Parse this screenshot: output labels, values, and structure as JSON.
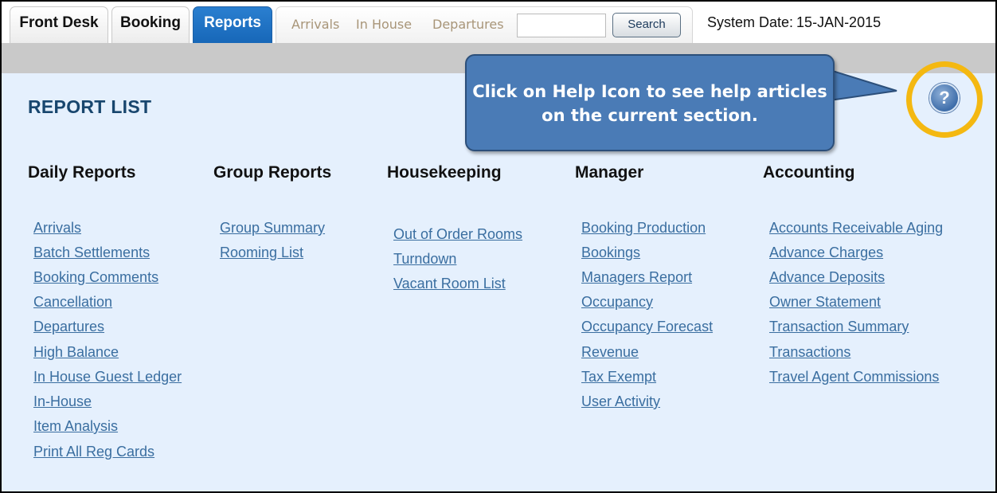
{
  "tabs": {
    "front_desk": "Front Desk",
    "booking": "Booking",
    "reports": "Reports"
  },
  "subnav": {
    "arrivals": "Arrivals",
    "in_house": "In House",
    "departures": "Departures",
    "search_value": "",
    "search_button": "Search"
  },
  "system_date": {
    "label": "System Date:",
    "value": "15-JAN-2015"
  },
  "page_title": "REPORT LIST",
  "callout": {
    "line1": "Click on Help Icon to see help articles",
    "line2": "on the current section."
  },
  "help_icon_glyph": "?",
  "columns": [
    {
      "heading": "Daily Reports",
      "links": [
        "Arrivals",
        "Batch Settlements",
        "Booking Comments",
        "Cancellation",
        "Departures",
        "High Balance",
        "In House Guest Ledger",
        "In-House",
        "Item Analysis",
        "Print All Reg Cards"
      ]
    },
    {
      "heading": "Group Reports",
      "links": [
        "Group Summary",
        "Rooming List"
      ]
    },
    {
      "heading": "Housekeeping",
      "links": [
        "Out of Order Rooms",
        "Turndown",
        "Vacant Room List"
      ]
    },
    {
      "heading": "Manager",
      "links": [
        "Booking Production",
        "Bookings",
        "Managers Report",
        "Occupancy",
        "Occupancy Forecast",
        "Revenue",
        "Tax Exempt",
        "User Activity"
      ]
    },
    {
      "heading": "Accounting",
      "links": [
        "Accounts Receivable Aging",
        "Advance Charges",
        "Advance Deposits",
        "Owner Statement",
        "Transaction Summary",
        "Transactions",
        "Travel Agent Commissions"
      ]
    }
  ],
  "colors": {
    "active_tab": "#1767b8",
    "content_bg": "#e5f0fd",
    "link": "#3a6ea0",
    "highlight_ring": "#f4b811",
    "callout_bg": "#4a7bb6"
  }
}
